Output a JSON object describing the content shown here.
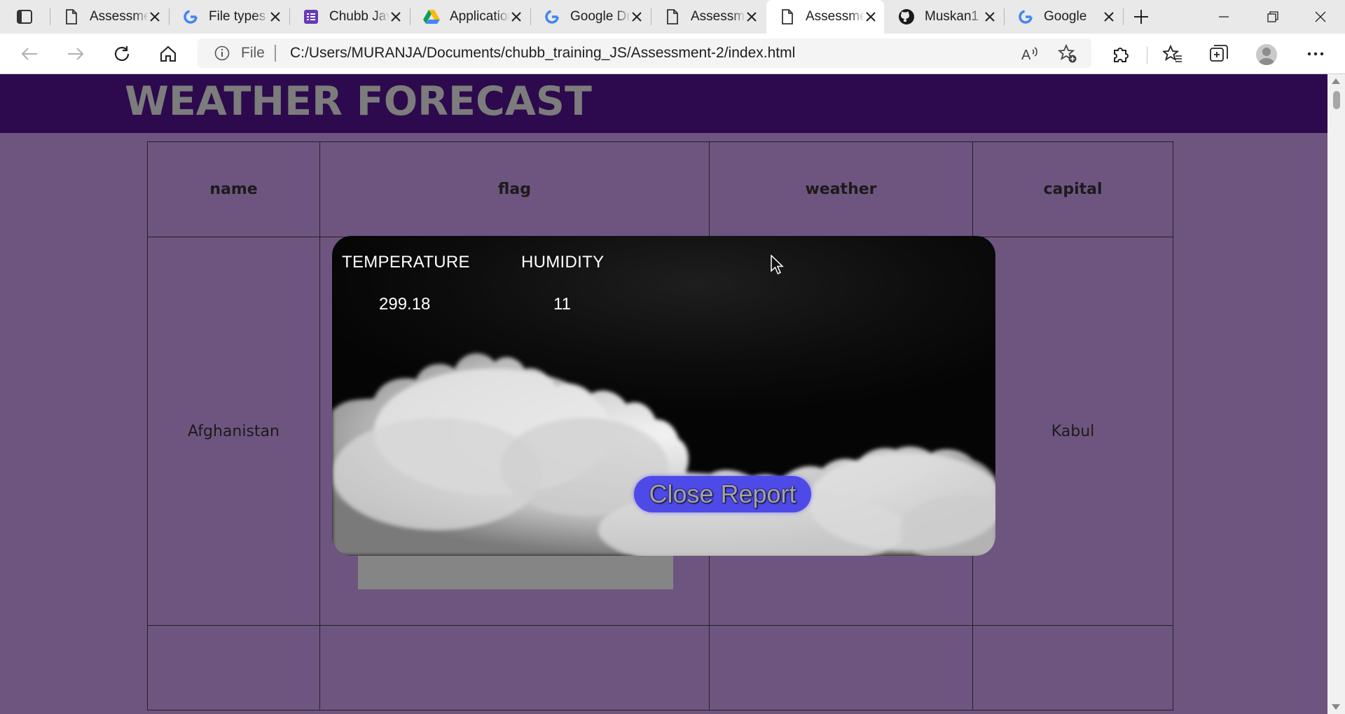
{
  "browser": {
    "tabs": [
      {
        "title": "Assessment",
        "favicon": "page-icon",
        "active": false
      },
      {
        "title": "File types",
        "favicon": "google-icon",
        "active": false
      },
      {
        "title": "Chubb Java",
        "favicon": "forms-icon",
        "active": false
      },
      {
        "title": "Applications",
        "favicon": "drive-icon",
        "active": false
      },
      {
        "title": "Google Drive",
        "favicon": "google-icon",
        "active": false
      },
      {
        "title": "Assessment",
        "favicon": "page-icon",
        "active": false
      },
      {
        "title": "Assessment",
        "favicon": "page-icon",
        "active": true
      },
      {
        "title": "Muskan1",
        "favicon": "github-icon",
        "active": false
      },
      {
        "title": "Google",
        "favicon": "google-icon",
        "active": false
      }
    ],
    "address": {
      "scheme_label": "File",
      "url": "C:/Users/MURANJA/Documents/chubb_training_JS/Assessment-2/index.html"
    }
  },
  "page": {
    "title": "WEATHER FORECAST",
    "table": {
      "headers": [
        "name",
        "flag",
        "weather",
        "capital"
      ],
      "rows": [
        {
          "name": "Afghanistan",
          "flag": "",
          "weather": "",
          "capital": "Kabul"
        }
      ]
    },
    "report": {
      "temperature_label": "TEMPERATURE",
      "humidity_label": "HUMIDITY",
      "temperature_value": "299.18",
      "humidity_value": "11",
      "close_label": "Close Report"
    }
  },
  "colors": {
    "header_band": "#2d094d",
    "page_background": "#6e5580",
    "title_text": "#7c7c7c",
    "close_button": "#4e4ae8"
  }
}
